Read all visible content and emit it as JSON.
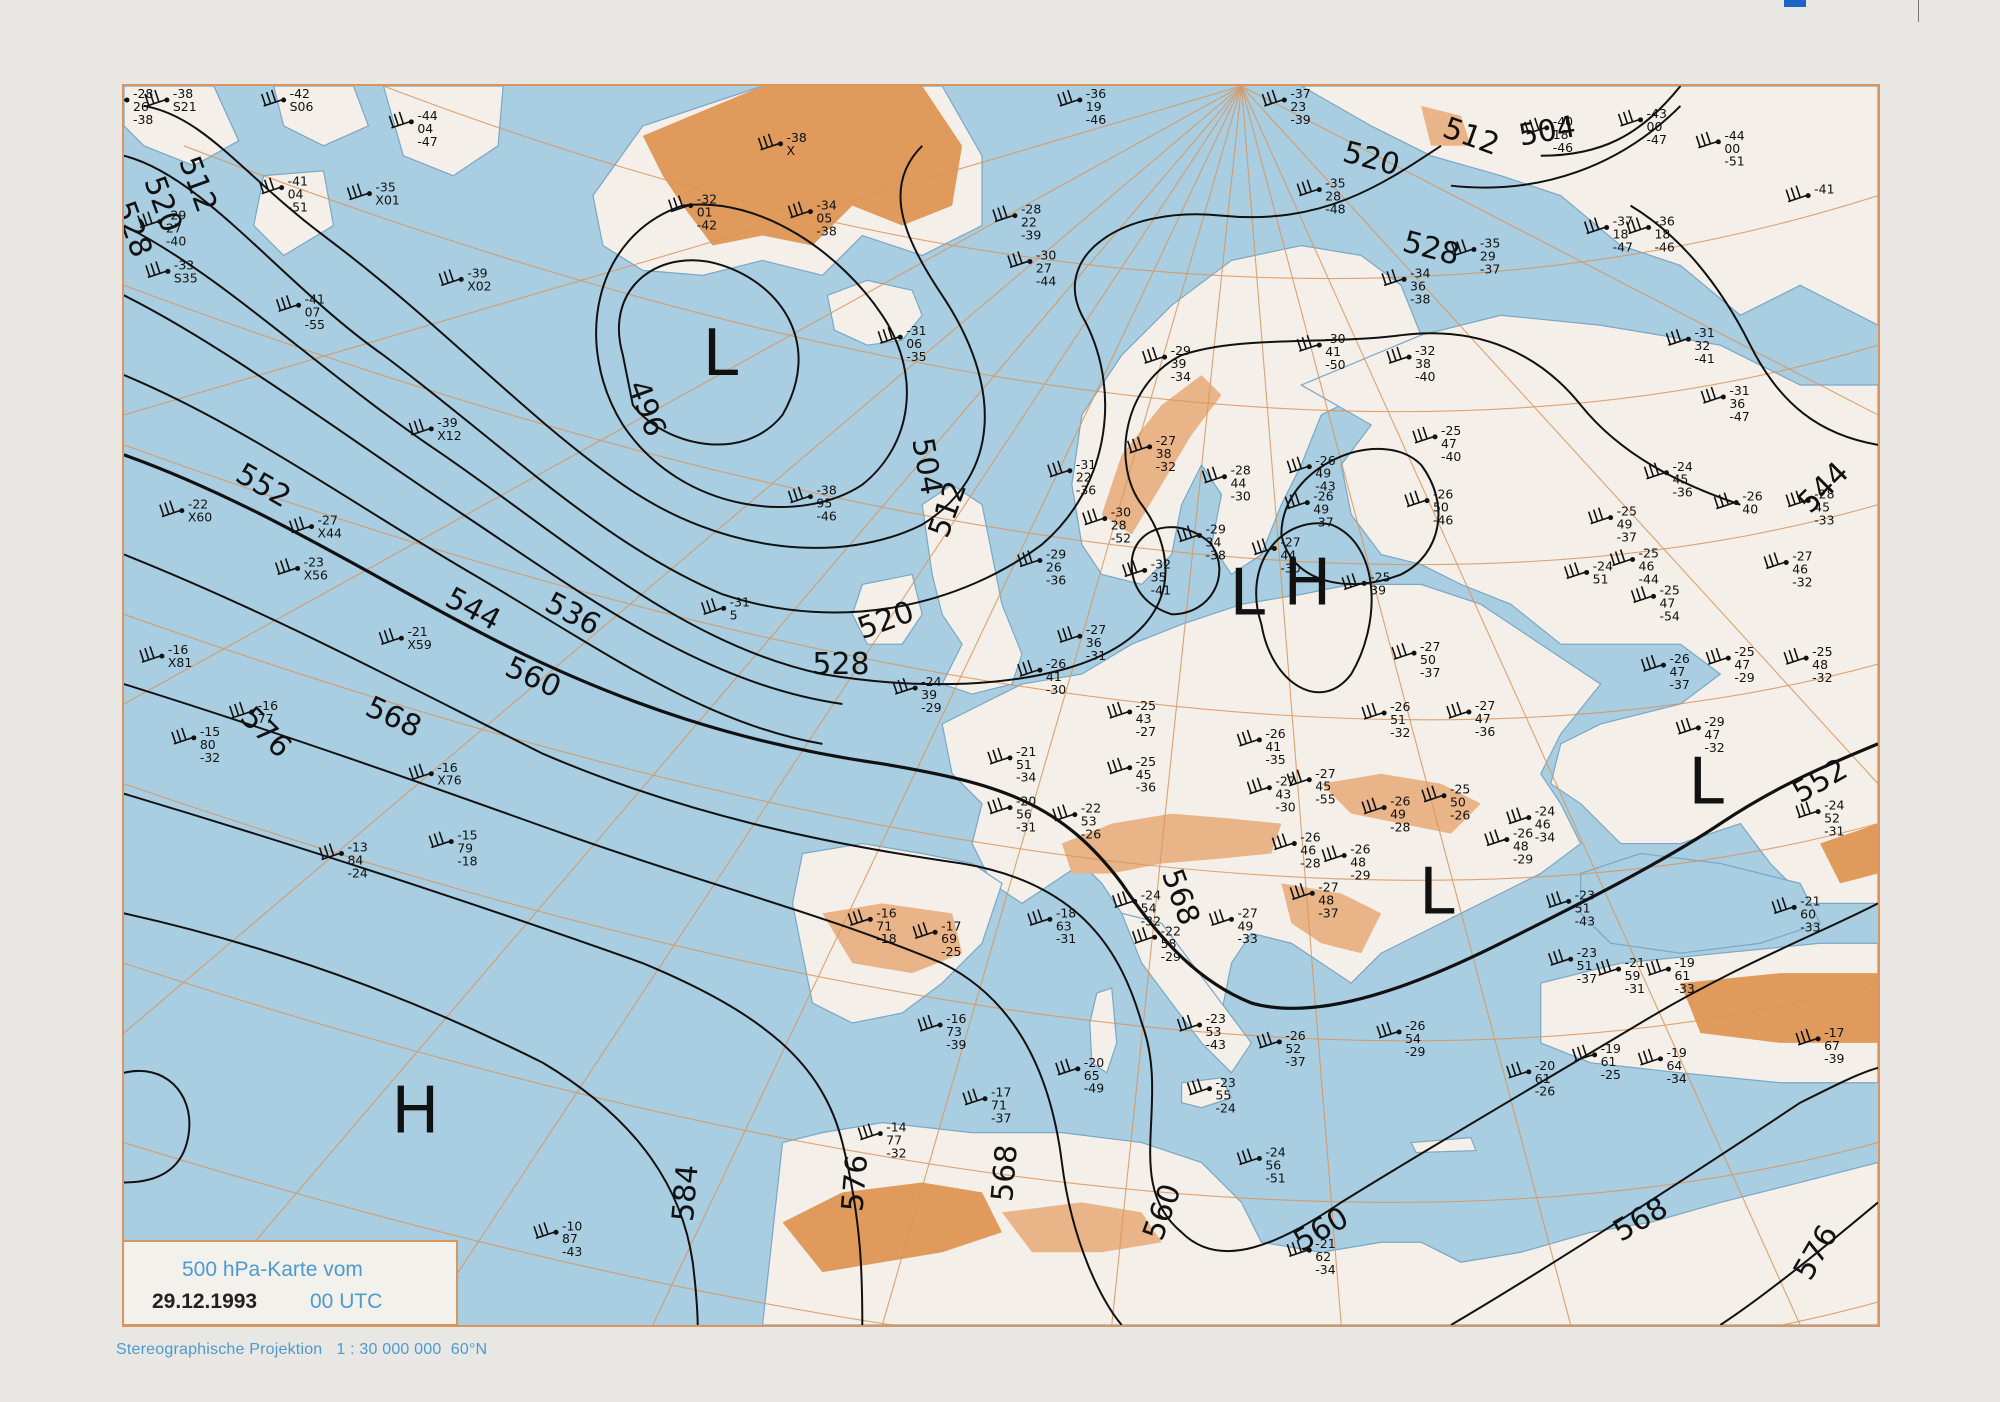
{
  "legend": {
    "title": "500 hPa-Karte vom",
    "date": "29.12.1993",
    "time": "00 UTC"
  },
  "footer": {
    "projection_note": "Stereographische Projektion   1 : 30 000 000  60°N"
  },
  "colors": {
    "sea": "#a9cde1",
    "land": "#f4efe8",
    "high_terrain": "#e9b487",
    "highest_terrain": "#df9a5c",
    "graticule": "#d9955d",
    "contour": "#111111",
    "frame": "#d9955d",
    "legend_text": "#4d9ad0"
  },
  "contour_labels": [
    "496",
    "504",
    "512",
    "520",
    "528",
    "536",
    "544",
    "552",
    "560",
    "568",
    "576",
    "584"
  ],
  "centers": [
    {
      "name": "low-north-atlantic",
      "symbol": "L"
    },
    {
      "name": "high-atlantic",
      "symbol": "H"
    },
    {
      "name": "low-scandinavia",
      "symbol": "L"
    },
    {
      "name": "high-baltic",
      "symbol": "H"
    },
    {
      "name": "low-balkans",
      "symbol": "L"
    },
    {
      "name": "low-black-sea",
      "symbol": "L"
    }
  ],
  "station_plots": [
    [
      "-38",
      "X",
      ""
    ],
    [
      "-32",
      "01",
      "-42"
    ],
    [
      "-34",
      "05",
      "-38"
    ],
    [
      "-31",
      "06",
      "-35"
    ],
    [
      "-38",
      "95",
      "-46"
    ],
    [
      "-31",
      "5",
      ""
    ],
    [
      "-28",
      "22",
      "-39"
    ],
    [
      "-30",
      "27",
      "-44"
    ],
    [
      "-36",
      "19",
      "-46"
    ],
    [
      "-37",
      "23",
      "-39"
    ],
    [
      "-35",
      "28",
      "-48"
    ],
    [
      "-35",
      "29",
      "-37"
    ],
    [
      "-34",
      "36",
      "-38"
    ],
    [
      "-30",
      "41",
      "-50"
    ],
    [
      "-29",
      "39",
      "-34"
    ],
    [
      "-32",
      "38",
      "-40"
    ],
    [
      "-27",
      "38",
      "-32"
    ],
    [
      "-28",
      "44",
      "-30"
    ],
    [
      "-26",
      "49",
      "-43"
    ],
    [
      "-26",
      "49",
      "-37"
    ],
    [
      "-25",
      "47",
      "-40"
    ],
    [
      "-26",
      "50",
      "-46"
    ],
    [
      "-31",
      "22",
      "-36"
    ],
    [
      "-30",
      "28",
      "-52"
    ],
    [
      "-29",
      "26",
      "-36"
    ],
    [
      "-32",
      "35",
      "-41"
    ],
    [
      "-29",
      "34",
      "-38"
    ],
    [
      "-27",
      "44",
      "-30"
    ],
    [
      "-25",
      "39",
      ""
    ],
    [
      "-27",
      "50",
      "-37"
    ],
    [
      "-27",
      "36",
      "-31"
    ],
    [
      "-26",
      "41",
      "-30"
    ],
    [
      "-24",
      "39",
      "-29"
    ],
    [
      "-25",
      "43",
      "-27"
    ],
    [
      "-21",
      "51",
      "-34"
    ],
    [
      "-20",
      "56",
      "-31"
    ],
    [
      "-22",
      "53",
      "-26"
    ],
    [
      "-25",
      "45",
      "-36"
    ],
    [
      "-26",
      "41",
      "-35"
    ],
    [
      "-27",
      "43",
      "-30"
    ],
    [
      "-27",
      "45",
      "-55"
    ],
    [
      "-26",
      "51",
      "-32"
    ],
    [
      "-27",
      "47",
      "-36"
    ],
    [
      "-26",
      "49",
      "-28"
    ],
    [
      "-25",
      "50",
      "-26"
    ],
    [
      "-24",
      "46",
      "-34"
    ],
    [
      "-26",
      "46",
      "-28"
    ],
    [
      "-26",
      "48",
      "-29"
    ],
    [
      "-26",
      "48",
      "-29"
    ],
    [
      "-27",
      "48",
      "-37"
    ],
    [
      "-27",
      "49",
      "-33"
    ],
    [
      "-24",
      "54",
      "-32"
    ],
    [
      "-18",
      "63",
      "-31"
    ],
    [
      "-22",
      "58",
      "-29"
    ],
    [
      "-17",
      "69",
      "-25"
    ],
    [
      "-16",
      "71",
      "-18"
    ],
    [
      "-16",
      "73",
      "-39"
    ],
    [
      "-20",
      "65",
      "-49"
    ],
    [
      "-17",
      "71",
      "-37"
    ],
    [
      "-14",
      "77",
      "-32"
    ],
    [
      "-23",
      "53",
      "-43"
    ],
    [
      "-26",
      "52",
      "-37"
    ],
    [
      "-23",
      "55",
      "-24"
    ],
    [
      "-26",
      "54",
      "-29"
    ],
    [
      "-24",
      "56",
      "-51"
    ],
    [
      "-21",
      "62",
      "-34"
    ],
    [
      "-23",
      "51",
      "-43"
    ],
    [
      "-23",
      "51",
      "-37"
    ],
    [
      "-21",
      "59",
      "-31"
    ],
    [
      "-20",
      "61",
      "-26"
    ],
    [
      "-19",
      "61",
      "-25"
    ],
    [
      "-19",
      "64",
      "-34"
    ],
    [
      "-19",
      "61",
      "-33"
    ],
    [
      "-17",
      "67",
      "-39"
    ],
    [
      "-21",
      "60",
      "-33"
    ],
    [
      "-24",
      "52",
      "-31"
    ],
    [
      "-29",
      "47",
      "-32"
    ],
    [
      "-26",
      "47",
      "-37"
    ],
    [
      "-25",
      "47",
      "-29"
    ],
    [
      "-25",
      "48",
      "-32"
    ],
    [
      "-26",
      "40",
      ""
    ],
    [
      "-27",
      "46",
      "-32"
    ],
    [
      "-28",
      "45",
      "-33"
    ],
    [
      "-24",
      "45",
      "-36"
    ],
    [
      "-25",
      "46",
      "-44"
    ],
    [
      "-25",
      "47",
      "-54"
    ],
    [
      "-24",
      "51",
      ""
    ],
    [
      "-25",
      "49",
      "-37"
    ],
    [
      "-31",
      "36",
      "-47"
    ],
    [
      "-31",
      "32",
      "-41"
    ],
    [
      "-36",
      "18",
      "-46"
    ],
    [
      "-37",
      "18",
      "-47"
    ],
    [
      "-44",
      "00",
      "-51"
    ],
    [
      "-43",
      "00",
      "-47"
    ],
    [
      "-40",
      "18",
      "-46"
    ],
    [
      "-41",
      "",
      ""
    ],
    [
      "-28",
      "26",
      "-38"
    ],
    [
      "-38",
      "S21",
      ""
    ],
    [
      "-42",
      "S06",
      ""
    ],
    [
      "-44",
      "04",
      "-47"
    ],
    [
      "-41",
      "04",
      "-51"
    ],
    [
      "-29",
      "27",
      "-40"
    ],
    [
      "-33",
      "S35",
      ""
    ],
    [
      "-41",
      "07",
      "-55"
    ],
    [
      "-35",
      "X01",
      ""
    ],
    [
      "-39",
      "X02",
      ""
    ],
    [
      "-39",
      "X12",
      ""
    ],
    [
      "-22",
      "X60",
      ""
    ],
    [
      "-27",
      "X44",
      ""
    ],
    [
      "-23",
      "X56",
      ""
    ],
    [
      "-21",
      "X59",
      ""
    ],
    [
      "-16",
      "X81",
      ""
    ],
    [
      "-15",
      "80",
      "-32"
    ],
    [
      "-16",
      "77",
      ""
    ],
    [
      "-16",
      "X76",
      ""
    ],
    [
      "-15",
      "79",
      "-18"
    ],
    [
      "-13",
      "84",
      "-24"
    ],
    [
      "-10",
      "87",
      "-43"
    ]
  ]
}
